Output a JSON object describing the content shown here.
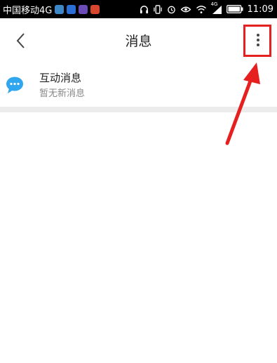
{
  "status_bar": {
    "carrier": "中国移动4G",
    "time": "11:09",
    "signal_label": "4G",
    "app_icons": [
      {
        "name": "app-notification-icon",
        "color": "#3d87c9"
      },
      {
        "name": "app-notification-icon",
        "color": "#2b6fd6"
      },
      {
        "name": "app-notification-icon",
        "color": "#6a4bb8"
      },
      {
        "name": "app-notification-icon",
        "color": "#d9462e"
      }
    ]
  },
  "nav": {
    "title": "消息",
    "back_icon": "chevron-left-icon",
    "more_icon": "more-vertical-icon"
  },
  "messages": {
    "items": [
      {
        "title": "互动消息",
        "subtitle": "暂无新消息",
        "icon": "chat-bubble-icon",
        "icon_color": "#2fa6ee"
      }
    ]
  },
  "annotation": {
    "color": "#e6201f"
  }
}
